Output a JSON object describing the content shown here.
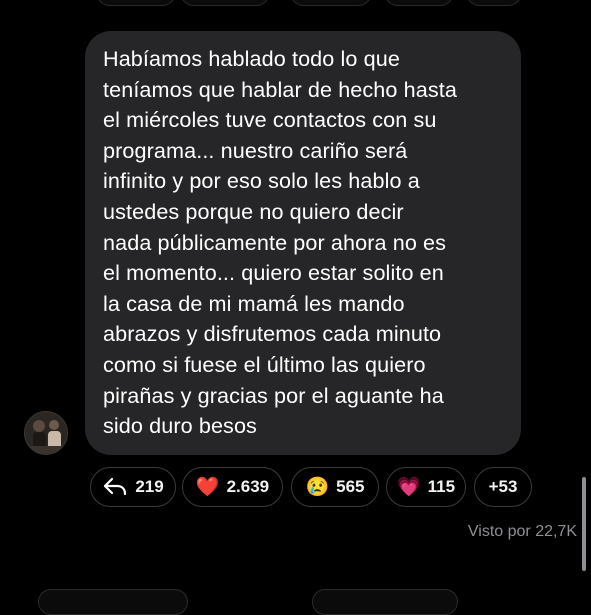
{
  "message": {
    "text": "Habíamos hablado todo lo que\nteníamos que hablar de hecho hasta\nel miércoles tuve contactos con su\nprograma... nuestro cariño será\ninfinito y por eso solo les hablo a\nustedes porque no quiero decir\nnada públicamente por ahora no es\nel momento... quiero estar solito en\nla casa de mi mamá les mando\nabrazos y disfrutemos cada minuto\ncomo si fuese el último las quiero\npirañas y gracias por el aguante ha\nsido duro besos"
  },
  "reactions": [
    {
      "icon": "reply-arrow-icon",
      "count": "219"
    },
    {
      "icon": "heart-emoji",
      "emoji": "❤️",
      "count": "2.639"
    },
    {
      "icon": "crying-face-emoji",
      "emoji": "😢",
      "count": "565"
    },
    {
      "icon": "sparkling-heart-emoji",
      "emoji": "💗",
      "count": "115"
    },
    {
      "more": "+53"
    }
  ],
  "seen_by": "Visto por 22,7K",
  "colors": {
    "background": "#000000",
    "bubble": "#262628",
    "muted_text": "#8e8e93"
  }
}
